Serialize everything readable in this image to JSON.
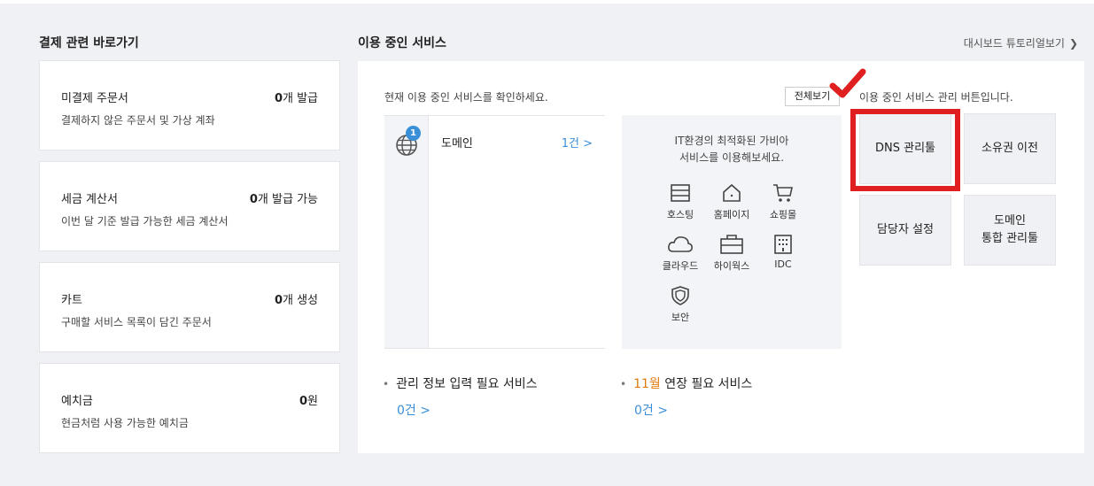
{
  "payment": {
    "title": "결제 관련 바로가기",
    "cards": [
      {
        "title": "미결제 주문서",
        "desc": "결제하지 않은 주문서 및 가상 계좌",
        "num": "0",
        "unit": "개 발급"
      },
      {
        "title": "세금 계산서",
        "desc": "이번 달 기준 발급 가능한 세금 계산서",
        "num": "0",
        "unit": "개 발급 가능"
      },
      {
        "title": "카트",
        "desc": "구매할 서비스 목록이 담긴 주문서",
        "num": "0",
        "unit": "개 생성"
      },
      {
        "title": "예치금",
        "desc": "현금처럼 사용 가능한 예치금",
        "num": "0",
        "unit": "원"
      }
    ]
  },
  "services": {
    "title": "이용 중인 서비스",
    "tutorial_link": "대시보드 튜토리얼보기",
    "intro": "현재 이용 중인 서비스를 확인하세요.",
    "domain": {
      "label": "도메인",
      "count": "1건 >",
      "badge": "1"
    },
    "recommend": {
      "line1": "IT환경의 최적화된 가비아",
      "line2": "서비스를 이용해보세요.",
      "items": [
        {
          "label": "호스팅",
          "icon": "hosting-icon"
        },
        {
          "label": "홈페이지",
          "icon": "home-icon"
        },
        {
          "label": "쇼핑몰",
          "icon": "cart-icon"
        },
        {
          "label": "클라우드",
          "icon": "cloud-icon"
        },
        {
          "label": "하이웍스",
          "icon": "briefcase-icon"
        },
        {
          "label": "IDC",
          "icon": "building-icon"
        },
        {
          "label": "보안",
          "icon": "shield-icon"
        }
      ]
    },
    "view_all": "전체보기",
    "manage_note": "이용 중인 서비스 관리 버튼입니다.",
    "manage_buttons": {
      "dns": "DNS 관리툴",
      "transfer": "소유권 이전",
      "contact": "담당자 설정",
      "domain_line1": "도메인",
      "domain_line2": "통합 관리툴"
    },
    "info_required": {
      "label": "관리 정보 입력 필요 서비스",
      "count": "0건 >"
    },
    "renewal": {
      "month": "11월",
      "label": " 연장 필요 서비스",
      "count": "0건 >"
    }
  },
  "colors": {
    "accent": "#3a8fd9",
    "highlight": "#e02020",
    "month": "#e07b12"
  }
}
